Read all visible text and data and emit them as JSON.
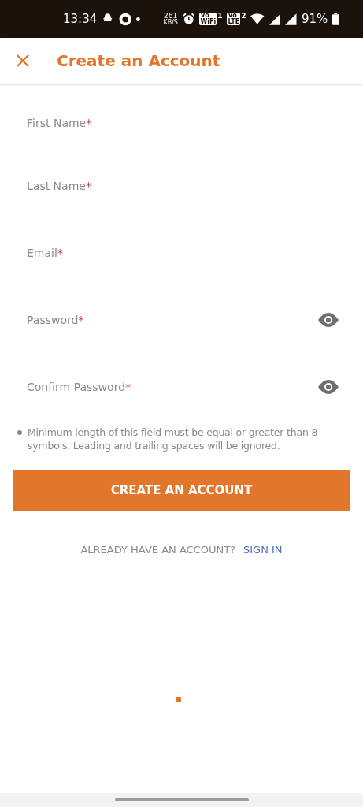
{
  "status_bar": {
    "time": "13:34",
    "speed": "261",
    "speed_unit": "KB/S",
    "badges": [
      {
        "top": "Vo",
        "bottom": "WiFi",
        "index": "1"
      },
      {
        "top": "Vo",
        "bottom": "LTE",
        "index": "2"
      }
    ],
    "battery": "91%"
  },
  "header": {
    "title": "Create an Account"
  },
  "fields": [
    {
      "kind": "text",
      "placeholder": "First Name",
      "mark": "*"
    },
    {
      "kind": "text",
      "placeholder": "Last Name",
      "mark": "*"
    },
    {
      "kind": "text",
      "placeholder": "Email",
      "mark": "*"
    },
    {
      "kind": "password",
      "placeholder": "Password",
      "mark": "*"
    },
    {
      "kind": "password",
      "placeholder": "Confirm Password",
      "mark": "*"
    }
  ],
  "hint": "Minimum length of this field must be equal or greater than 8 symbols. Leading and trailing spaces will be ignored.",
  "submit": "CREATE AN ACCOUNT",
  "footer": {
    "prompt": "ALREADY HAVE AN ACCOUNT?",
    "link": "SIGN IN"
  }
}
